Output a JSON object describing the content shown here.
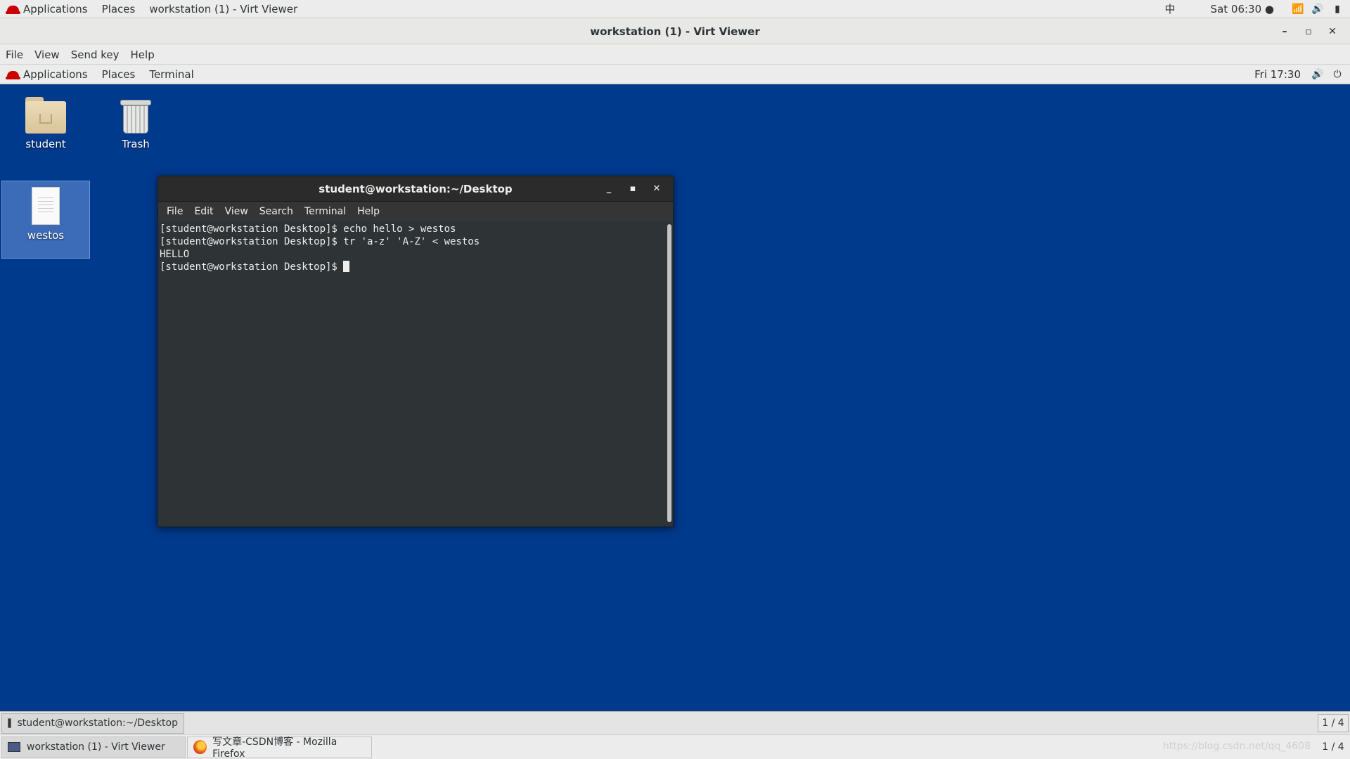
{
  "host_topbar": {
    "applications": "Applications",
    "places": "Places",
    "active_window": "workstation (1) - Virt Viewer",
    "input_method": "中",
    "clock": "Sat 06:30 ●"
  },
  "viewer": {
    "title": "workstation (1) - Virt Viewer",
    "menu": [
      "File",
      "View",
      "Send key",
      "Help"
    ]
  },
  "guest_topbar": {
    "applications": "Applications",
    "places": "Places",
    "terminal": "Terminal",
    "clock": "Fri 17:30"
  },
  "desktop_icons": [
    {
      "label": "student"
    },
    {
      "label": "Trash"
    },
    {
      "label": "westos"
    }
  ],
  "terminal": {
    "title": "student@workstation:~/Desktop",
    "menu": [
      "File",
      "Edit",
      "View",
      "Search",
      "Terminal",
      "Help"
    ],
    "lines": [
      "[student@workstation Desktop]$ echo hello > westos",
      "[student@workstation Desktop]$ tr 'a-z' 'A-Z' < westos",
      "HELLO",
      "[student@workstation Desktop]$ "
    ]
  },
  "guest_taskbar": {
    "task": "student@workstation:~/Desktop",
    "pager": "1 / 4"
  },
  "host_taskbar": {
    "tasks": [
      "workstation (1) - Virt Viewer",
      "写文章-CSDN博客 - Mozilla Firefox"
    ],
    "watermark": "https://blog.csdn.net/qq_4608",
    "pager": "1 / 4"
  },
  "colors": {
    "desktop_bg": "#003a8c",
    "terminal_bg": "#2e3436",
    "redhat": "#cc0000"
  }
}
